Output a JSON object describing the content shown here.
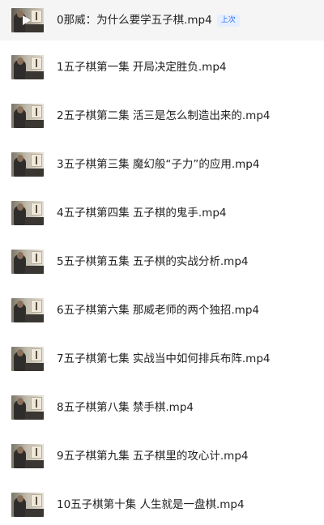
{
  "playlist": {
    "items": [
      {
        "title": "0那威：为什么要学五子棋.mp4",
        "badge": "上次",
        "active": true
      },
      {
        "title": "1五子棋第一集 开局决定胜负.mp4"
      },
      {
        "title": "2五子棋第二集 活三是怎么制造出来的.mp4"
      },
      {
        "title": "3五子棋第三集 魔幻般“子力”的应用.mp4"
      },
      {
        "title": "4五子棋第四集 五子棋的鬼手.mp4"
      },
      {
        "title": "5五子棋第五集 五子棋的实战分析.mp4"
      },
      {
        "title": "6五子棋第六集 那威老师的两个独招.mp4"
      },
      {
        "title": "7五子棋第七集 实战当中如何排兵布阵.mp4"
      },
      {
        "title": "8五子棋第八集 禁手棋.mp4"
      },
      {
        "title": "9五子棋第九集 五子棋里的攻心计.mp4"
      },
      {
        "title": "10五子棋第十集 人生就是一盘棋.mp4"
      }
    ],
    "colors": {
      "active_row_bg": "#f5f5f5",
      "badge_text": "#2a6cf0",
      "badge_bg": "#e6efff",
      "title_text": "#222222"
    },
    "icons": {
      "play": "play-icon",
      "thumbnail": "video-thumbnail"
    }
  }
}
